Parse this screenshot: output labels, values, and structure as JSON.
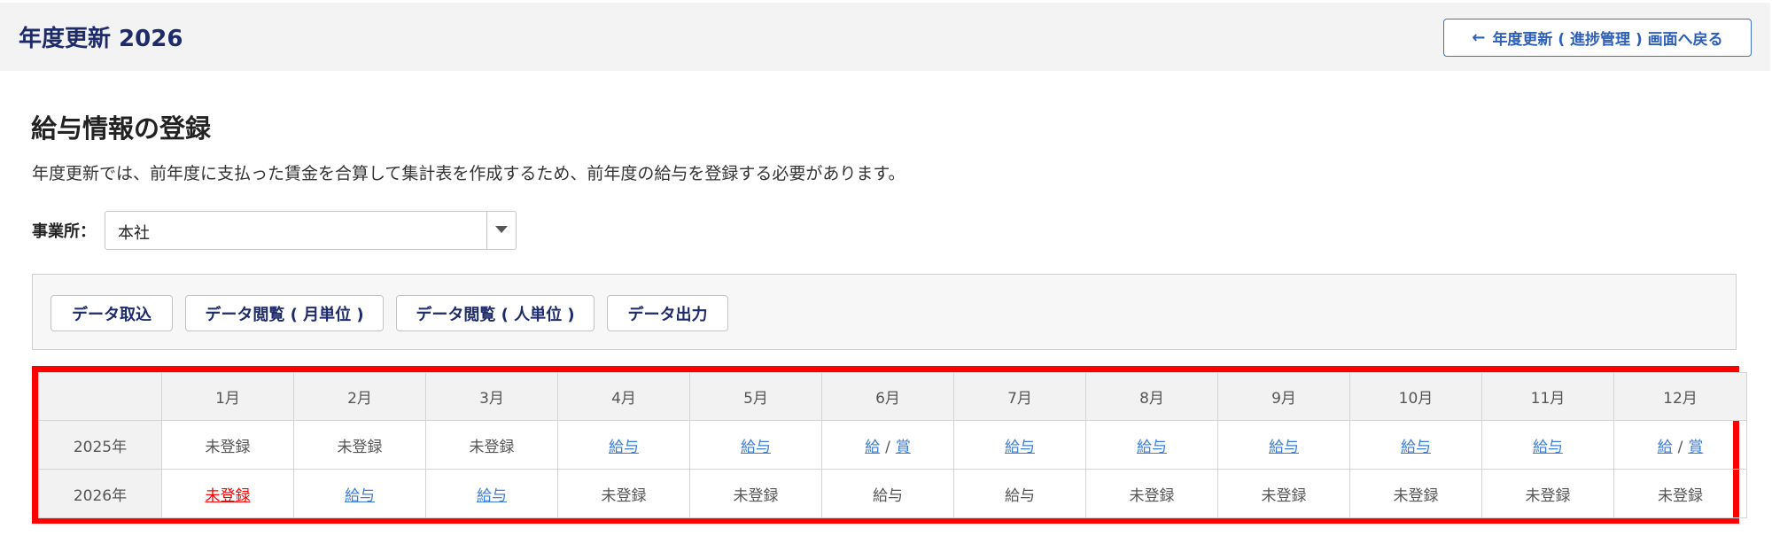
{
  "header": {
    "title": "年度更新 2026",
    "back_label": "年度更新 ( 進捗管理 ) 画面へ戻る",
    "back_icon": "arrow-left-icon"
  },
  "page": {
    "title": "給与情報の登録",
    "description": "年度更新では、前年度に支払った賃金を合算して集計表を作成するため、前年度の給与を登録する必要があります。"
  },
  "office": {
    "label": "事業所：",
    "selected": "本社"
  },
  "toolbar": {
    "import_label": "データ取込",
    "view_month_label": "データ閲覧 ( 月単位 )",
    "view_person_label": "データ閲覧 ( 人単位 )",
    "export_label": "データ出力"
  },
  "grid": {
    "months": [
      "1月",
      "2月",
      "3月",
      "4月",
      "5月",
      "6月",
      "7月",
      "8月",
      "9月",
      "10月",
      "11月",
      "12月"
    ],
    "rows": [
      {
        "year": "2025年",
        "cells": [
          {
            "type": "text",
            "text": "未登録"
          },
          {
            "type": "text",
            "text": "未登録"
          },
          {
            "type": "text",
            "text": "未登録"
          },
          {
            "type": "link",
            "text": "給与"
          },
          {
            "type": "link",
            "text": "給与"
          },
          {
            "type": "pair",
            "a": "給",
            "sep": "/",
            "b": "賞"
          },
          {
            "type": "link",
            "text": "給与"
          },
          {
            "type": "link",
            "text": "給与"
          },
          {
            "type": "link",
            "text": "給与"
          },
          {
            "type": "link",
            "text": "給与"
          },
          {
            "type": "link",
            "text": "給与"
          },
          {
            "type": "pair",
            "a": "給",
            "sep": "/",
            "b": "賞"
          }
        ]
      },
      {
        "year": "2026年",
        "cells": [
          {
            "type": "link-red",
            "text": "未登録"
          },
          {
            "type": "link",
            "text": "給与"
          },
          {
            "type": "link",
            "text": "給与"
          },
          {
            "type": "text",
            "text": "未登録"
          },
          {
            "type": "text",
            "text": "未登録"
          },
          {
            "type": "text",
            "text": "給与"
          },
          {
            "type": "text",
            "text": "給与"
          },
          {
            "type": "text",
            "text": "未登録"
          },
          {
            "type": "text",
            "text": "未登録"
          },
          {
            "type": "text",
            "text": "未登録"
          },
          {
            "type": "text",
            "text": "未登録"
          },
          {
            "type": "text",
            "text": "未登録"
          }
        ]
      }
    ]
  },
  "colors": {
    "highlight_border": "#ff0000",
    "link": "#3c7ed6",
    "link_alert": "#ff0000",
    "title": "#1d2b6b"
  }
}
